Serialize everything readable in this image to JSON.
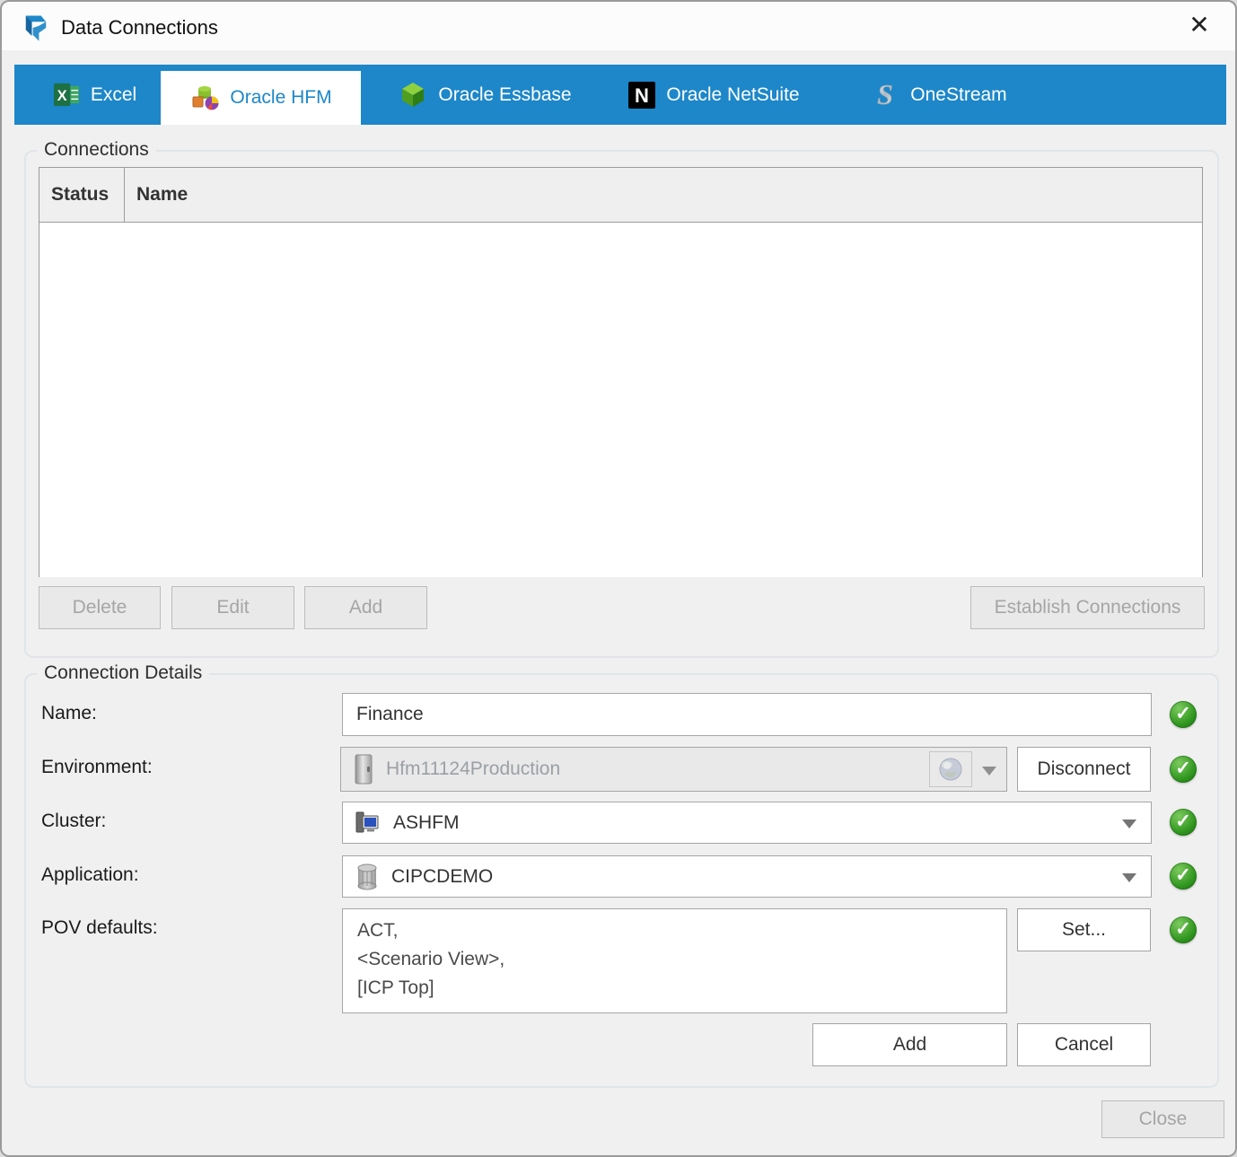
{
  "window": {
    "title": "Data Connections",
    "close_icon": "✕"
  },
  "tabs": [
    {
      "label": "Excel",
      "icon_letter": "X",
      "active": false
    },
    {
      "label": "Oracle HFM",
      "active": true
    },
    {
      "label": "Oracle Essbase",
      "active": false
    },
    {
      "label": "Oracle NetSuite",
      "icon_letter": "N",
      "active": false
    },
    {
      "label": "OneStream",
      "active": false
    }
  ],
  "connections": {
    "legend": "Connections",
    "columns": [
      "Status",
      "Name"
    ],
    "rows": [],
    "delete_label": "Delete",
    "edit_label": "Edit",
    "add_label": "Add",
    "establish_label": "Establish Connections"
  },
  "details": {
    "legend": "Connection Details",
    "name_label": "Name:",
    "name_value": "Finance",
    "environment_label": "Environment:",
    "environment_value": "Hfm11124Production",
    "disconnect_label": "Disconnect",
    "cluster_label": "Cluster:",
    "cluster_value": "ASHFM",
    "application_label": "Application:",
    "application_value": "CIPCDEMO",
    "pov_label": "POV defaults:",
    "pov_value": "ACT,\n<Scenario View>,\n[ICP Top]",
    "set_label": "Set...",
    "add_label": "Add",
    "cancel_label": "Cancel"
  },
  "footer": {
    "close_label": "Close"
  },
  "colors": {
    "accent": "#1d87c9",
    "success": "#2f961f"
  }
}
